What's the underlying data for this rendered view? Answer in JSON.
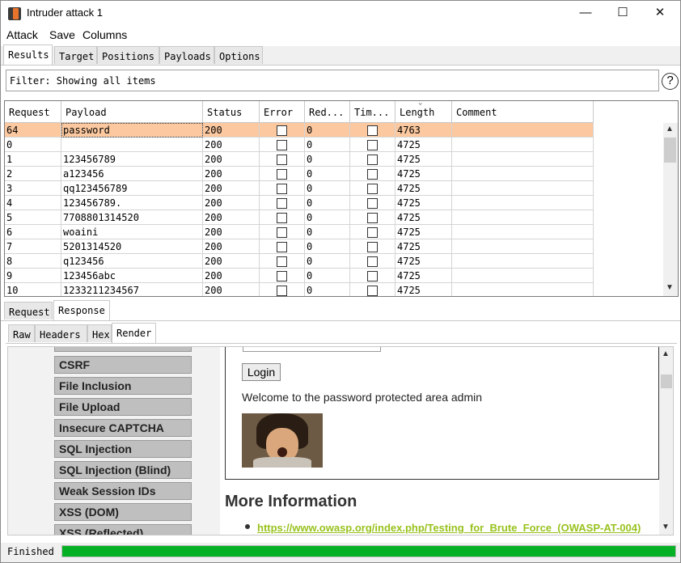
{
  "window": {
    "title": "Intruder attack 1",
    "min": "—",
    "max": "☐",
    "close": "✕"
  },
  "menu": [
    "Attack",
    "Save",
    "Columns"
  ],
  "main_tabs": [
    "Results",
    "Target",
    "Positions",
    "Payloads",
    "Options"
  ],
  "active_main_tab": "Results",
  "filter": {
    "text": "Filter: Showing all items",
    "help": "?"
  },
  "table": {
    "columns": [
      "Request",
      "Payload",
      "Status",
      "Error",
      "Red...",
      "Tim...",
      "Length",
      "Comment"
    ],
    "sort_column": "Length",
    "rows": [
      {
        "request": "64",
        "payload": "password",
        "status": "200",
        "redirects": "0",
        "length": "4763",
        "selected": true
      },
      {
        "request": "0",
        "payload": "",
        "status": "200",
        "redirects": "0",
        "length": "4725"
      },
      {
        "request": "1",
        "payload": "123456789",
        "status": "200",
        "redirects": "0",
        "length": "4725"
      },
      {
        "request": "2",
        "payload": "a123456",
        "status": "200",
        "redirects": "0",
        "length": "4725"
      },
      {
        "request": "3",
        "payload": "qq123456789",
        "status": "200",
        "redirects": "0",
        "length": "4725"
      },
      {
        "request": "4",
        "payload": "123456789.",
        "status": "200",
        "redirects": "0",
        "length": "4725"
      },
      {
        "request": "5",
        "payload": "7708801314520",
        "status": "200",
        "redirects": "0",
        "length": "4725"
      },
      {
        "request": "6",
        "payload": "woaini",
        "status": "200",
        "redirects": "0",
        "length": "4725"
      },
      {
        "request": "7",
        "payload": "5201314520",
        "status": "200",
        "redirects": "0",
        "length": "4725"
      },
      {
        "request": "8",
        "payload": "q123456",
        "status": "200",
        "redirects": "0",
        "length": "4725"
      },
      {
        "request": "9",
        "payload": "123456abc",
        "status": "200",
        "redirects": "0",
        "length": "4725"
      },
      {
        "request": "10",
        "payload": "1233211234567",
        "status": "200",
        "redirects": "0",
        "length": "4725"
      }
    ]
  },
  "detail_tabs": [
    "Request",
    "Response"
  ],
  "active_detail_tab": "Response",
  "view_tabs": [
    "Raw",
    "Headers",
    "Hex",
    "Render"
  ],
  "active_view_tab": "Render",
  "render": {
    "menu_items": [
      "CSRF",
      "File Inclusion",
      "File Upload",
      "Insecure CAPTCHA",
      "SQL Injection",
      "SQL Injection (Blind)",
      "Weak Session IDs",
      "XSS (DOM)",
      "XSS (Reflected)"
    ],
    "login_button": "Login",
    "welcome": "Welcome to the password protected area admin",
    "more_info_heading": "More Information",
    "link": "https://www.owasp.org/index.php/Testing_for_Brute_Force_(OWASP-AT-004)"
  },
  "status": {
    "text": "Finished",
    "progress": 1.0
  },
  "colors": {
    "selected_row": "#fbc89f",
    "progress": "#06b025",
    "link": "#98c21d"
  }
}
